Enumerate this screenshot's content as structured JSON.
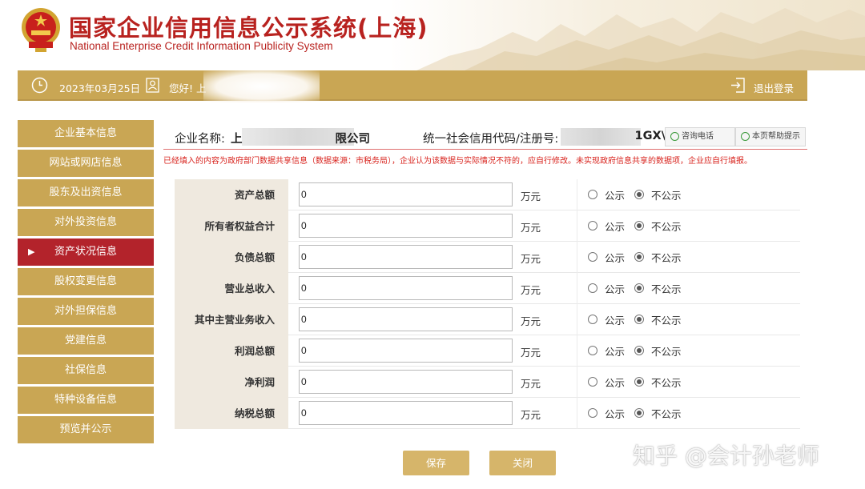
{
  "header": {
    "title_cn": "国家企业信用信息公示系统(上海)",
    "title_en": "National Enterprise Credit Information Publicity System"
  },
  "topbar": {
    "date": "2023年03月25日",
    "greeting": "您好! 上",
    "logout": "退出登录"
  },
  "sidebar": {
    "items": [
      {
        "label": "企业基本信息"
      },
      {
        "label": "网站或网店信息"
      },
      {
        "label": "股东及出资信息"
      },
      {
        "label": "对外投资信息"
      },
      {
        "label": "资产状况信息"
      },
      {
        "label": "股权变更信息"
      },
      {
        "label": "对外担保信息"
      },
      {
        "label": "党建信息"
      },
      {
        "label": "社保信息"
      },
      {
        "label": "特种设备信息"
      },
      {
        "label": "预览并公示"
      }
    ],
    "active_marker": "▶"
  },
  "company": {
    "name_label": "企业名称:",
    "name_value": "上　　　　　　　　限公司",
    "code_label": "统一社会信用代码/注册号:",
    "code_value": "1GX\\",
    "consult_btn": "咨询电话",
    "help_btn": "本页帮助提示"
  },
  "notice": "已经填入的内容为政府部门数据共享信息（数据来源：市税务局），企业认为该数据与实际情况不符的，应自行修改。未实现政府信息共享的数据项，企业应自行填报。",
  "form": {
    "unit": "万元",
    "public_label": "公示",
    "private_label": "不公示",
    "rows": [
      {
        "label": "资产总额",
        "value": "0",
        "publish": "不公示"
      },
      {
        "label": "所有者权益合计",
        "value": "0",
        "publish": "不公示"
      },
      {
        "label": "负债总额",
        "value": "0",
        "publish": "不公示"
      },
      {
        "label": "营业总收入",
        "value": "0",
        "publish": "不公示"
      },
      {
        "label": "其中主营业务收入",
        "value": "0",
        "publish": "不公示"
      },
      {
        "label": "利润总额",
        "value": "0",
        "publish": "不公示"
      },
      {
        "label": "净利润",
        "value": "0",
        "publish": "不公示"
      },
      {
        "label": "纳税总额",
        "value": "0",
        "publish": "不公示"
      }
    ]
  },
  "actions": {
    "save": "保存",
    "close": "关闭"
  },
  "watermark": "知乎 @会计孙老师",
  "colors": {
    "gold": "#c9a654",
    "active_red": "#b3232b",
    "title_red": "#b8221f",
    "notice_red": "#d8231d"
  }
}
